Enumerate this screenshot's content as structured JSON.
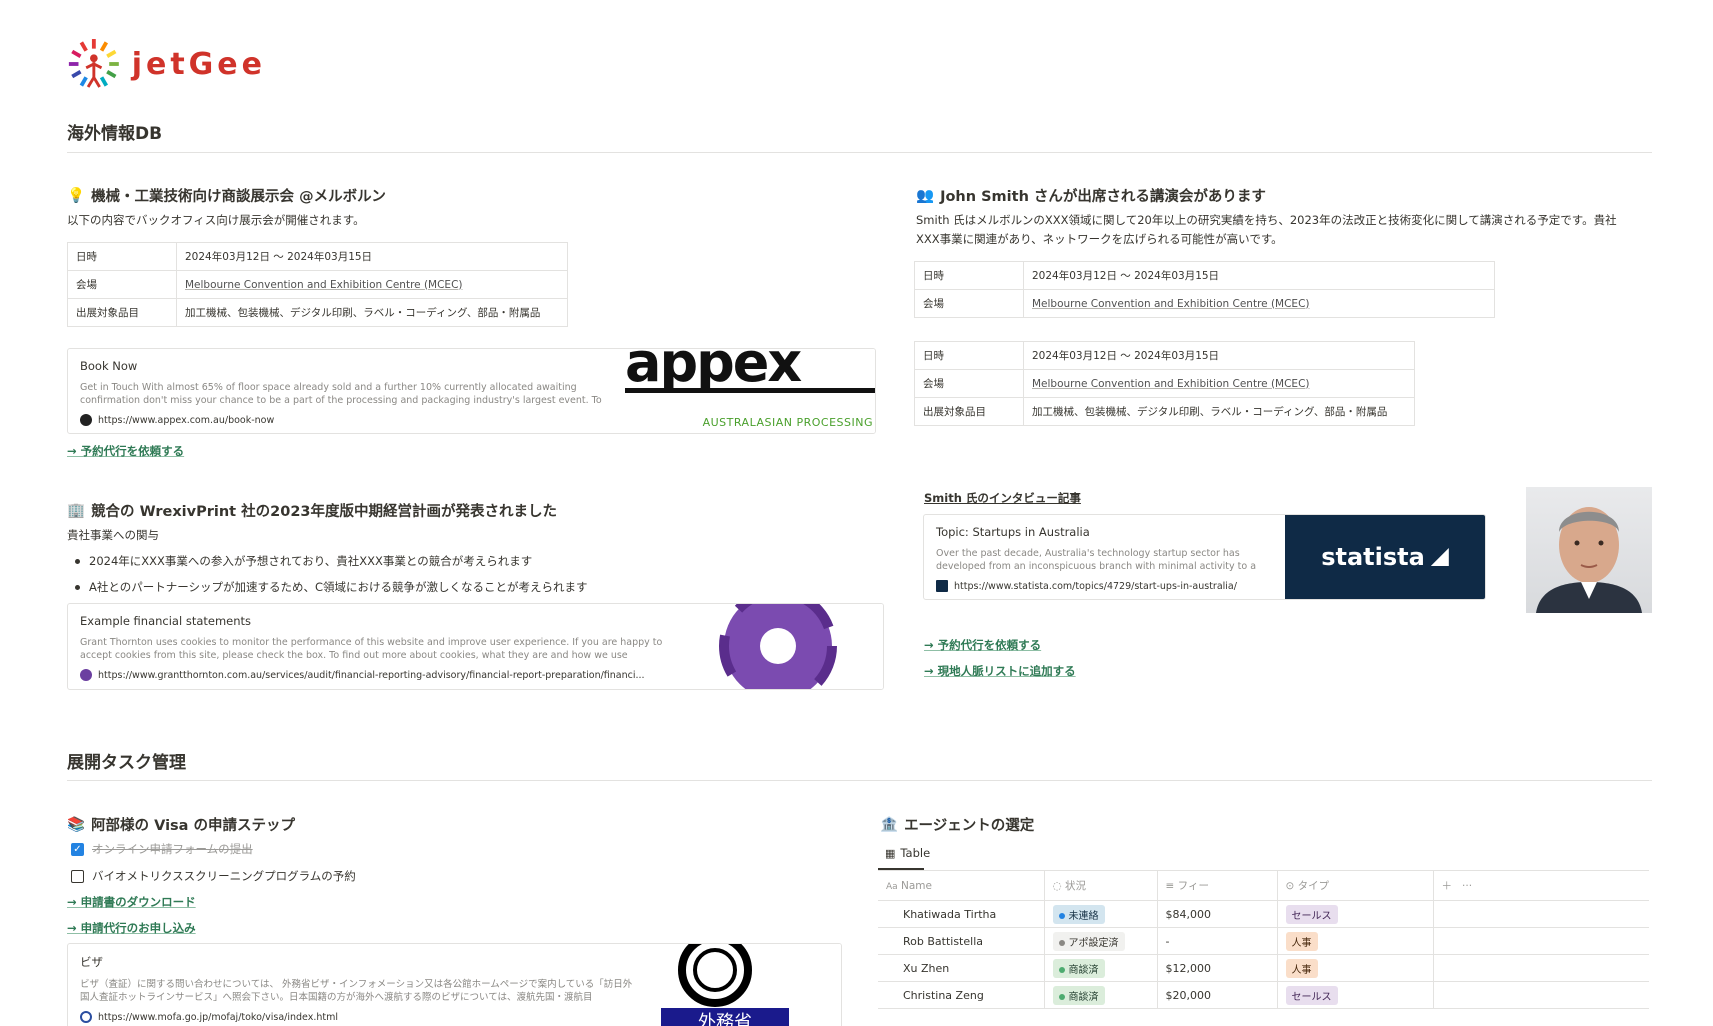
{
  "logo": {
    "text": "jetGee"
  },
  "section1": {
    "title": "海外情報DB"
  },
  "card1": {
    "icon": "lightbulb-icon",
    "title": "機械・工業技術向け商談展示会 @メルボルン",
    "intro": "以下の内容でバックオフィス向け展示会が開催されます。",
    "props": [
      {
        "key": "日時",
        "value": "2024年03月12日 〜 2024年03月15日"
      },
      {
        "key": "会場",
        "value": "Melbourne Convention and Exhibition Centre (MCEC)"
      },
      {
        "key": "出展対象品目",
        "value": "加工機械、包装機械、デジタル印刷、ラベル・コーディング、部品・附属品"
      }
    ],
    "bookmark": {
      "title": "Book Now",
      "desc": "Get in Touch With almost 65% of floor space already sold and a further 10% currently allocated awaiting confirmation don't miss your chance to be a part of the processing and packaging industry's largest event. To enquire about",
      "url": "https://www.appex.com.au/book-now",
      "img_text": "appex",
      "img_sub": "AUSTRALASIAN PROCESSING"
    },
    "link": "→ 予約代行を依頼する"
  },
  "card2": {
    "icon": "people-icon",
    "title": "John Smith さんが出席される講演会があります",
    "intro_1": "Smith 氏はメルボルンのXXX領域に関して20年以上の研究実績を持ち、2023年の法改正と技術変化に関して講演される予定です。貴社",
    "intro_2": "XXX事業に関連があり、ネットワークを広げられる可能性が高いです。",
    "props_a": [
      {
        "key": "日時",
        "value": "2024年03月12日 〜 2024年03月15日"
      },
      {
        "key": "会場",
        "value": "Melbourne Convention and Exhibition Centre (MCEC)"
      }
    ],
    "props_b": [
      {
        "key": "日時",
        "value": "2024年03月12日 〜 2024年03月15日"
      },
      {
        "key": "会場",
        "value": "Melbourne Convention and Exhibition Centre (MCEC)"
      },
      {
        "key": "出展対象品目",
        "value": "加工機械、包装機械、デジタル印刷、ラベル・コーディング、部品・附属品"
      }
    ],
    "interview_link": "Smith 氏のインタビュー記事",
    "bookmark": {
      "title": "Topic: Startups in Australia",
      "desc": "Over the past decade, Australia's technology startup sector has developed from an inconspicuous branch with minimal activity to a thriving hub of",
      "url": "https://www.statista.com/topics/4729/start-ups-in-australia/",
      "img_text": "statista"
    },
    "link_1": "→ 予約代行を依頼する",
    "link_2": "→ 現地人脈リストに追加する"
  },
  "card3": {
    "icon": "building-icon",
    "title": "競合の WrexivPrint 社の2023年度版中期経営計画が発表されました",
    "intro": "貴社事業への関与",
    "bullets": [
      "2024年にXXX事業への参入が予想されており、貴社XXX事業との競合が考えられます",
      "A社とのパートナーシップが加速するため、C領域における競争が激しくなることが考えられます"
    ],
    "bookmark": {
      "title": "Example financial statements",
      "desc": "Grant Thornton uses cookies to monitor the performance of this website and improve user experience. If you are happy to accept cookies from this site, please check the box. To find out more about cookies, what they are and how we use",
      "url": "https://www.grantthornton.com.au/services/audit/financial-reporting-advisory/financial-report-preparation/financi..."
    }
  },
  "section2": {
    "title": "展開タスク管理"
  },
  "card4": {
    "icon": "books-icon",
    "title": "阿部様の Visa の申請ステップ",
    "todos": [
      {
        "text_struck": "オンライン申請フォーム",
        "text": "の提出",
        "checked": true
      },
      {
        "text_struck": "",
        "text": "バイオメトリクススクリーニングプログラムの予約",
        "checked": false
      }
    ],
    "link_1": "→ 申請書のダウンロード",
    "link_2": "→ 申請代行のお申し込み",
    "bookmark": {
      "title": "ビザ",
      "desc": "ビザ（査証）に関する問い合わせについては、 外務省ビザ・インフォメーション又は各公館ホームページで案内している「訪日外国人査証ホットラインサービス」へ照会下さい。日本国籍の方が海外へ渡航する際のビザについては、渡航先国・渡航目",
      "url": "https://www.mofa.go.jp/mofaj/toko/visa/index.html",
      "img_text": "外務省"
    }
  },
  "card5": {
    "icon": "bank-icon",
    "title": "エージェントの選定",
    "view_tab": "Table",
    "columns": {
      "name": "Name",
      "status": "状況",
      "fee": "フィー",
      "type": "タイプ"
    },
    "rows": [
      {
        "name": "Khatiwada Tirtha",
        "status": "未連絡",
        "fee": "$84,000",
        "type": "セールス"
      },
      {
        "name": "Rob Battistella",
        "status": "アポ設定済",
        "fee": "-",
        "type": "人事"
      },
      {
        "name": "Xu Zhen",
        "status": "商談済",
        "fee": "$12,000",
        "type": "人事"
      },
      {
        "name": "Christina Zeng",
        "status": "商談済",
        "fee": "$20,000",
        "type": "セールス"
      }
    ]
  }
}
